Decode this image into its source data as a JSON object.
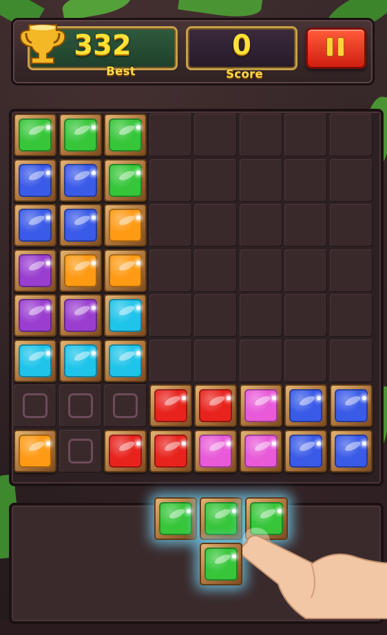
{
  "header": {
    "best_value": "332",
    "best_label": "Best",
    "score_value": "0",
    "score_label": "Score"
  },
  "board": {
    "rows": 8,
    "cols": 8,
    "cells": [
      [
        "green",
        "green",
        "green",
        null,
        null,
        null,
        null,
        null
      ],
      [
        "blue",
        "blue",
        "green",
        null,
        null,
        null,
        null,
        null
      ],
      [
        "blue",
        "blue",
        "orange",
        null,
        null,
        null,
        null,
        null
      ],
      [
        "purple",
        "orange",
        "orange",
        null,
        null,
        null,
        null,
        null
      ],
      [
        "purple",
        "purple",
        "cyan",
        null,
        null,
        null,
        null,
        null
      ],
      [
        "cyan",
        "cyan",
        "cyan",
        null,
        null,
        null,
        null,
        null
      ],
      [
        "hint",
        "hint",
        "hint",
        "red",
        "red",
        "pink",
        "blue",
        "blue"
      ],
      [
        "orange",
        "hint",
        "red",
        "red",
        "pink",
        "pink",
        "blue",
        "blue"
      ]
    ]
  },
  "tray_piece": {
    "color": "green",
    "shape": [
      [
        1,
        1,
        1
      ],
      [
        0,
        1,
        0
      ]
    ]
  },
  "colors": {
    "green": "#37c63a",
    "blue": "#3a5ae8",
    "orange": "#ff9a14",
    "purple": "#9a3ed0",
    "cyan": "#1fc4ea",
    "red": "#e8231d",
    "pink": "#e85ad8"
  },
  "icons": {
    "trophy": "trophy-icon",
    "pause": "pause-icon"
  }
}
